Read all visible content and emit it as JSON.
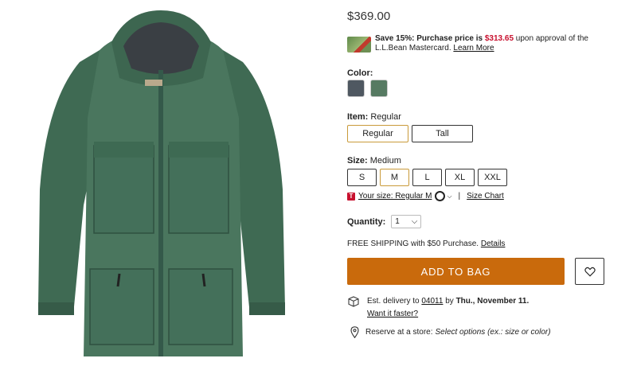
{
  "product": {
    "price": "$369.00",
    "image_alt": "Green parka jacket"
  },
  "promo": {
    "bold_prefix": "Save 15%: Purchase price is",
    "discount_price": "$313.65",
    "text_after": "upon approval of the L.L.Bean Mastercard.",
    "link": "Learn More"
  },
  "color": {
    "label": "Color:",
    "swatches": [
      {
        "name": "gray",
        "hex": "#4f5861"
      },
      {
        "name": "green",
        "hex": "#567a62"
      }
    ]
  },
  "item": {
    "label": "Item:",
    "value": "Regular",
    "options": [
      "Regular",
      "Tall"
    ]
  },
  "size": {
    "label": "Size:",
    "value": "Medium",
    "options": [
      "S",
      "M",
      "L",
      "XL",
      "XXL"
    ],
    "your_size": "Your size: Regular M",
    "size_chart": "Size Chart"
  },
  "quantity": {
    "label": "Quantity:",
    "value": "1"
  },
  "shipping": {
    "text": "FREE SHIPPING with $50 Purchase.",
    "link": "Details"
  },
  "cta": {
    "add_to_bag": "ADD TO BAG"
  },
  "delivery": {
    "prefix": "Est. delivery to",
    "zip": "04011",
    "by": "by",
    "date": "Thu., November 11.",
    "faster": "Want it faster?"
  },
  "reserve": {
    "prefix": "Reserve at a store:",
    "hint": "Select options (ex.: size or color)"
  },
  "colors": {
    "accent_orange": "#c96a0c",
    "sale_red": "#c8102e",
    "selected_border": "#c99a3a"
  }
}
